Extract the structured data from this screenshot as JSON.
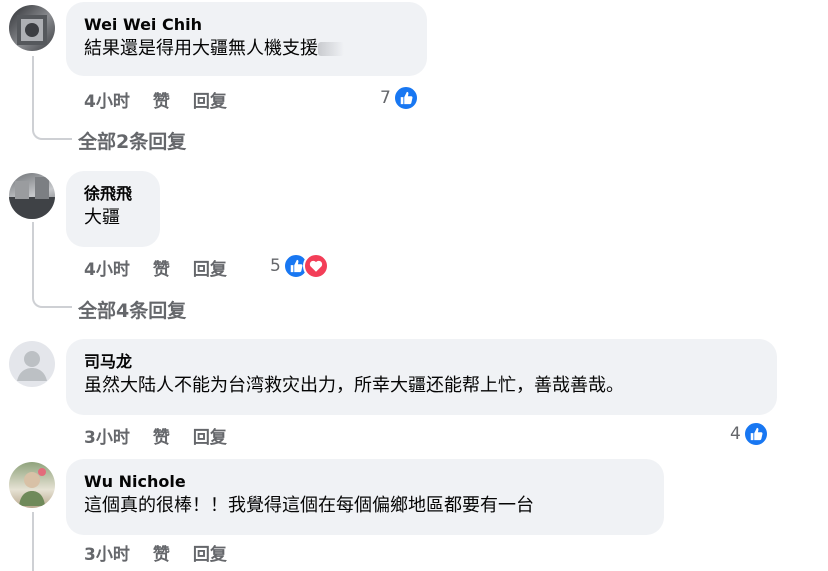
{
  "comments": [
    {
      "author": "Wei Wei Chih",
      "text": "結果還是得用大疆無人機支援",
      "time": "4小时",
      "like_label": "赞",
      "reply_label": "回复",
      "reaction_count": "7",
      "reactions": [
        "like-icon"
      ],
      "view_replies": "全部2条回复",
      "avatar": "photo-avatar"
    },
    {
      "author": "徐飛飛",
      "text": "大疆",
      "time": "4小时",
      "like_label": "赞",
      "reply_label": "回复",
      "reaction_count": "5",
      "reactions": [
        "like-icon",
        "love-icon"
      ],
      "view_replies": "全部4条回复",
      "avatar": "photo-avatar"
    },
    {
      "author": "司马龙",
      "text": "虽然大陆人不能为台湾救灾出力，所幸大疆还能帮上忙，善哉善哉。",
      "time": "3小时",
      "like_label": "赞",
      "reply_label": "回复",
      "reaction_count": "4",
      "reactions": [
        "like-icon"
      ],
      "avatar": "default-person-avatar"
    },
    {
      "author": "Wu Nichole",
      "text": "這個真的很棒！！我覺得這個在每個偏鄉地區都要有一台",
      "time": "3小时",
      "like_label": "赞",
      "reply_label": "回复",
      "avatar": "photo-avatar"
    }
  ],
  "colors": {
    "bubble": "#f0f2f5",
    "secondary_text": "#65676b",
    "like_blue": "#1877f2",
    "love_red": "#f33e58",
    "thread_line": "#ced0d4"
  }
}
